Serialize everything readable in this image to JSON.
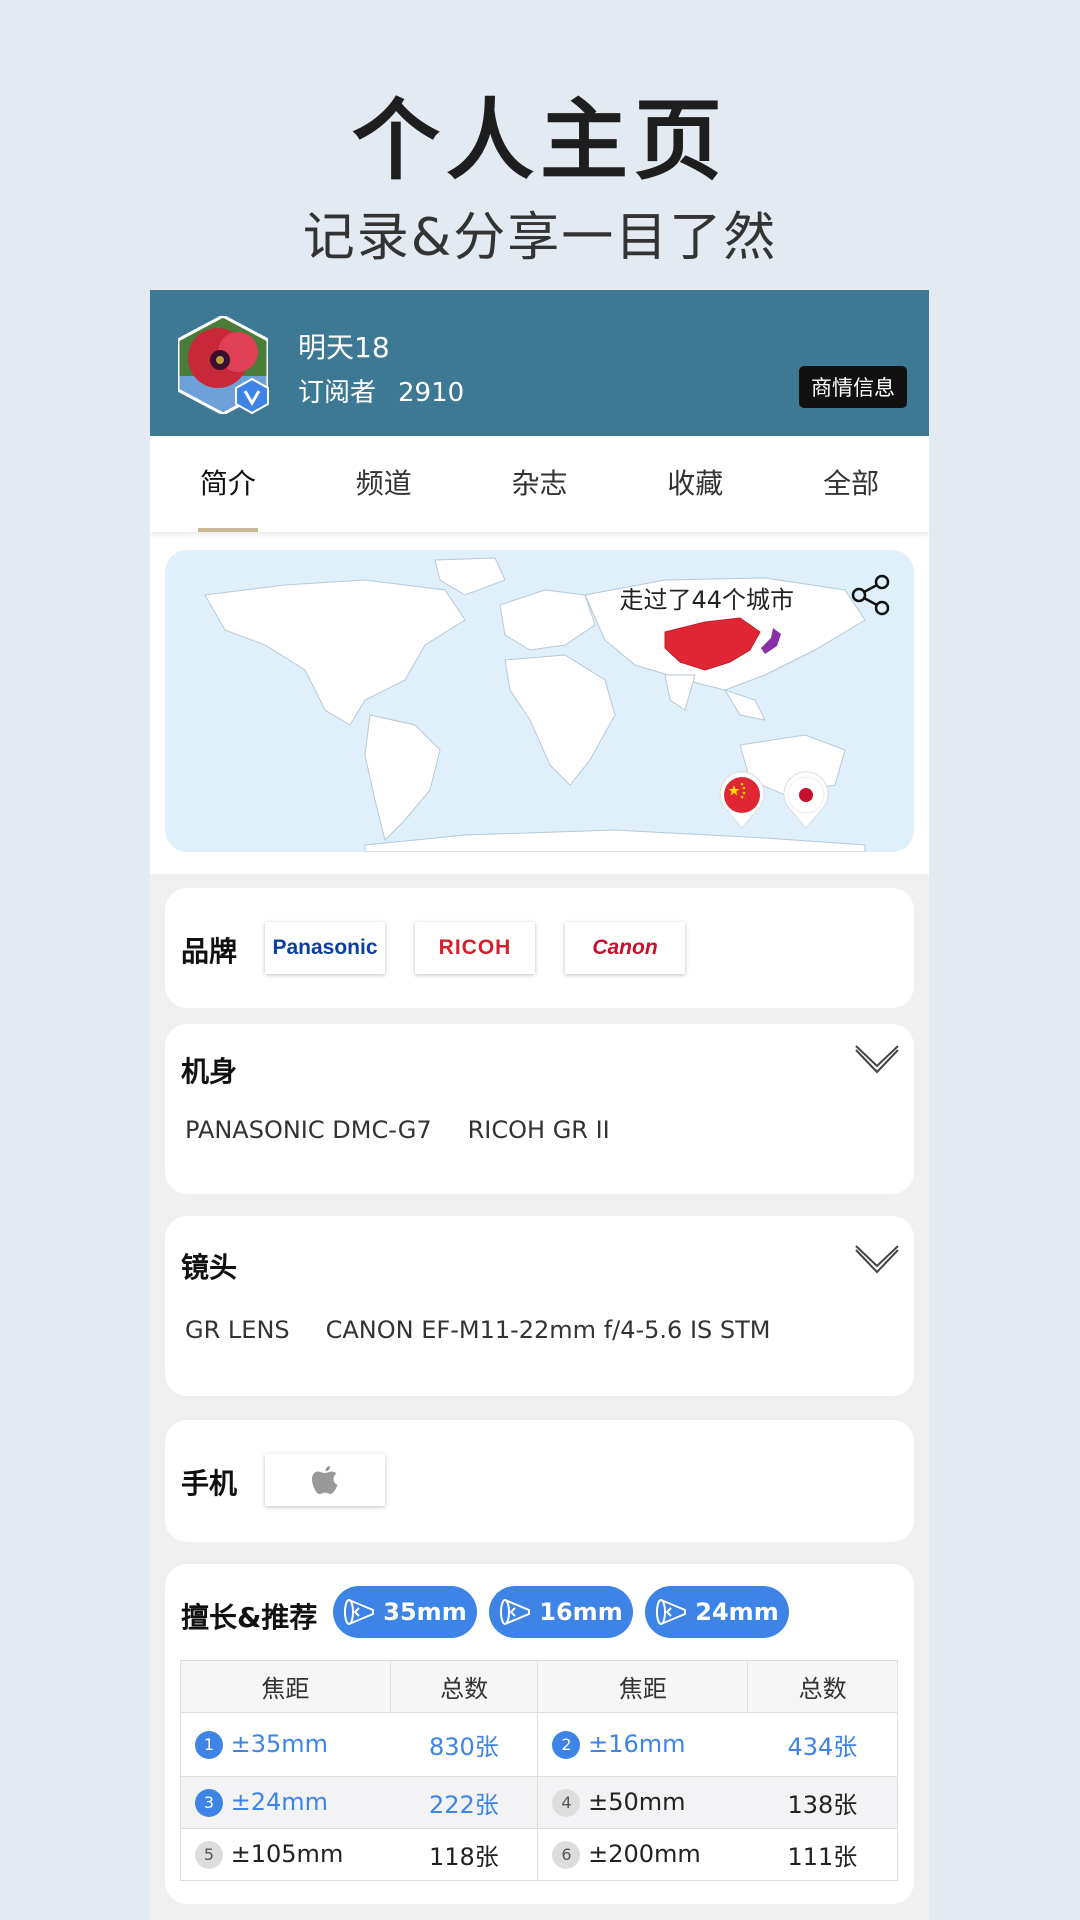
{
  "hero": {
    "title": "个人主页",
    "subtitle": "记录&分享一目了然"
  },
  "profile": {
    "username": "明天18",
    "subscribers_label": "订阅者",
    "subscribers_count": "2910",
    "biz_button": "商情信息"
  },
  "tabs": [
    "简介",
    "频道",
    "杂志",
    "收藏",
    "全部"
  ],
  "map": {
    "caption": "走过了44个城市"
  },
  "brands": {
    "title": "品牌",
    "items": [
      "Panasonic",
      "RICOH",
      "Canon"
    ]
  },
  "bodies": {
    "title": "机身",
    "items": [
      "PANASONIC DMC-G7",
      "RICOH GR II"
    ]
  },
  "lenses": {
    "title": "镜头",
    "items": [
      "GR LENS",
      "CANON EF-M11-22mm f/4-5.6 IS STM"
    ]
  },
  "phone": {
    "title": "手机"
  },
  "expertise": {
    "title": "擅长&推荐",
    "pills": [
      "35mm",
      "16mm",
      "24mm"
    ],
    "header": {
      "focal": "焦距",
      "total": "总数"
    },
    "rows": [
      [
        {
          "rank": "1",
          "focal": "±35mm",
          "count": "830张"
        },
        {
          "rank": "2",
          "focal": "±16mm",
          "count": "434张"
        }
      ],
      [
        {
          "rank": "3",
          "focal": "±24mm",
          "count": "222张"
        },
        {
          "rank": "4",
          "focal": "±50mm",
          "count": "138张"
        }
      ],
      [
        {
          "rank": "5",
          "focal": "±105mm",
          "count": "118张"
        },
        {
          "rank": "6",
          "focal": "±200mm",
          "count": "111张"
        }
      ]
    ]
  },
  "colors": {
    "header": "#3d7895",
    "accent": "#3d84e6",
    "china": "#e02634",
    "japan": "#8b2fa8"
  },
  "icons": [
    "verified-v-icon",
    "share-icon",
    "chevron-down-icon",
    "apple-icon",
    "focal-cone-icon",
    "china-flag-icon",
    "japan-flag-icon"
  ]
}
